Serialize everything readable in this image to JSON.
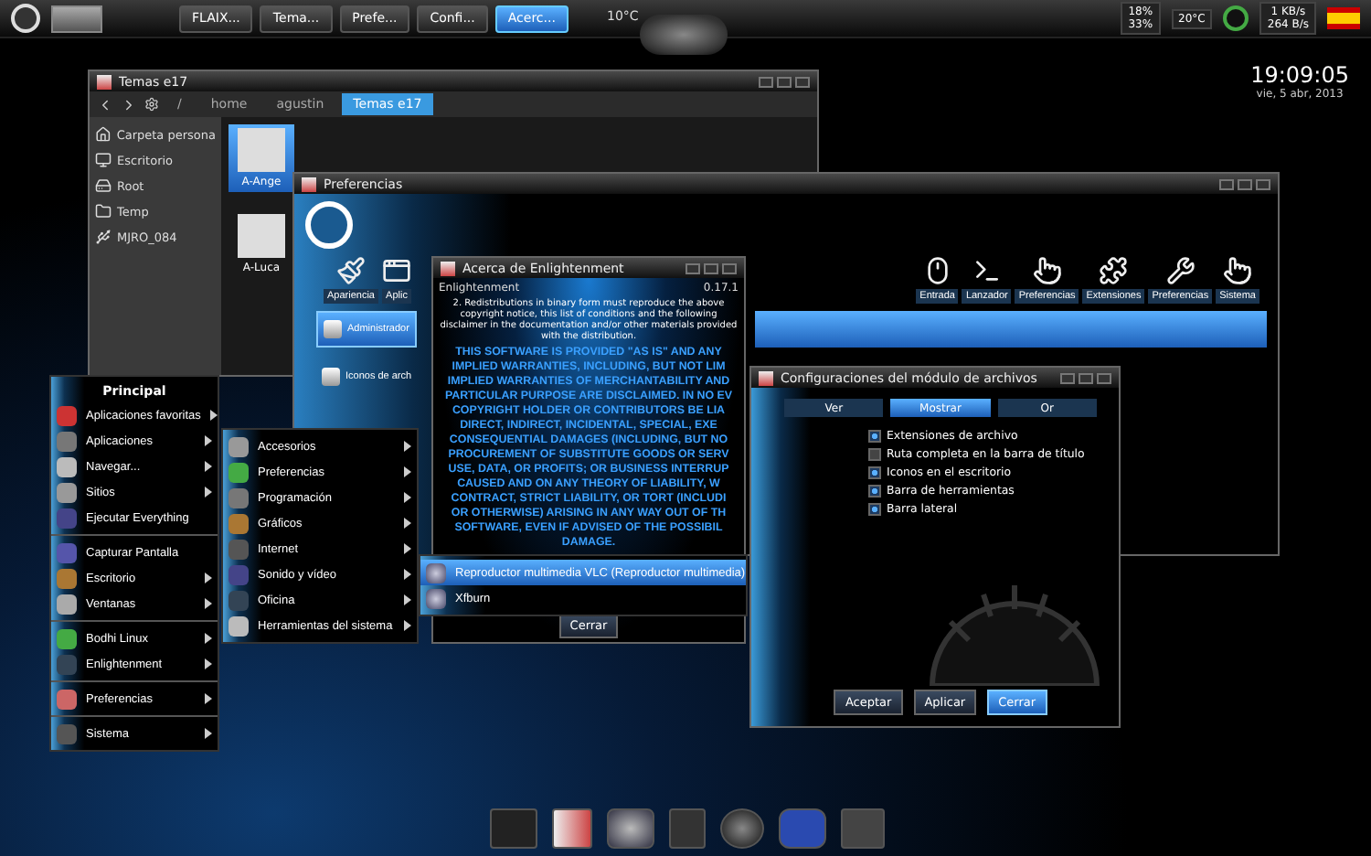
{
  "top_panel": {
    "tasks": [
      {
        "label": "FLAIX...",
        "selected": false
      },
      {
        "label": "Tema...",
        "selected": false
      },
      {
        "label": "Prefe...",
        "selected": false
      },
      {
        "label": "Confi...",
        "selected": false
      },
      {
        "label": "Acerc...",
        "selected": true
      }
    ],
    "weather": "10°C",
    "tray": {
      "cpu": [
        "18%",
        "33%"
      ],
      "temperature": "20°C",
      "net_down": "1 KB/s",
      "net_up": "264 B/s"
    }
  },
  "clock": {
    "time": "19:09:05",
    "date": "vie, 5 abr, 2013"
  },
  "file_window": {
    "title": "Temas e17",
    "path": [
      {
        "label": "/",
        "selected": false
      },
      {
        "label": "home",
        "selected": false
      },
      {
        "label": "agustin",
        "selected": false
      },
      {
        "label": "Temas e17",
        "selected": true
      }
    ],
    "places": [
      "Carpeta persona",
      "Escritorio",
      "Root",
      "Temp",
      "MJRO_084"
    ],
    "files": [
      {
        "name": "A-Ange",
        "selected": true
      },
      {
        "name": "A-Luca",
        "selected": false
      }
    ]
  },
  "prefs_window": {
    "title": "Preferencias",
    "category_groups": [
      [
        "Apariencia",
        "Aplic"
      ],
      [
        "Entrada",
        "Lanzador",
        "Preferencias",
        "Extensiones",
        "Preferencias",
        "Sistema"
      ]
    ],
    "list": [
      {
        "label": "Administrador",
        "selected": true
      },
      {
        "label": "Iconos de arch",
        "selected": false
      }
    ]
  },
  "about_window": {
    "title": "Acerca de Enlightenment",
    "name": "Enlightenment",
    "version": "0.17.1",
    "notice": "2. Redistributions in binary form must reproduce the above copyright notice, this list of conditions and the following disclaimer in the documentation and/or other materials provided with the distribution.",
    "disclaimer": [
      "THIS SOFTWARE IS PROVIDED \"AS IS\" AND ANY",
      "IMPLIED WARRANTIES, INCLUDING, BUT NOT LIM",
      "IMPLIED WARRANTIES OF MERCHANTABILITY AND",
      "PARTICULAR PURPOSE ARE DISCLAIMED. IN NO EV",
      "COPYRIGHT HOLDER OR CONTRIBUTORS BE LIA",
      "DIRECT, INDIRECT, INCIDENTAL, SPECIAL, EXE",
      "CONSEQUENTIAL DAMAGES (INCLUDING, BUT NO",
      "PROCUREMENT OF SUBSTITUTE GOODS OR SERV",
      "USE, DATA, OR PROFITS; OR BUSINESS INTERRUP",
      "CAUSED AND ON ANY THEORY OF LIABILITY, W",
      "CONTRACT, STRICT LIABILITY, OR TORT (INCLUDI",
      "OR OTHERWISE) ARISING IN ANY WAY OUT OF TH",
      "SOFTWARE, EVEN IF ADVISED OF THE POSSIBIL",
      "DAMAGE."
    ],
    "close_button": "Cerrar"
  },
  "main_menu": {
    "title": "Principal",
    "groups": [
      [
        {
          "label": "Aplicaciones favoritas",
          "submenu": true
        },
        {
          "label": "Aplicaciones",
          "submenu": true
        },
        {
          "label": "Navegar...",
          "submenu": true
        },
        {
          "label": "Sitios",
          "submenu": true
        },
        {
          "label": "Ejecutar Everything",
          "submenu": false
        }
      ],
      [
        {
          "label": "Capturar Pantalla",
          "submenu": false
        },
        {
          "label": "Escritorio",
          "submenu": true
        },
        {
          "label": "Ventanas",
          "submenu": true
        }
      ],
      [
        {
          "label": "Bodhi Linux",
          "submenu": true
        },
        {
          "label": "Enlightenment",
          "submenu": true
        }
      ],
      [
        {
          "label": "Preferencias",
          "submenu": true
        }
      ],
      [
        {
          "label": "Sistema",
          "submenu": true
        }
      ]
    ]
  },
  "apps_menu": {
    "items": [
      {
        "label": "Accesorios",
        "submenu": true
      },
      {
        "label": "Preferencias",
        "submenu": true
      },
      {
        "label": "Programación",
        "submenu": true
      },
      {
        "label": "Gráficos",
        "submenu": true
      },
      {
        "label": "Internet",
        "submenu": true
      },
      {
        "label": "Sonido y vídeo",
        "submenu": true
      },
      {
        "label": "Oficina",
        "submenu": true
      },
      {
        "label": "Herramientas del sistema",
        "submenu": true
      }
    ]
  },
  "video_menu": {
    "items": [
      {
        "label": "Reproductor multimedia VLC (Reproductor multimedia)",
        "selected": true
      },
      {
        "label": "Xfburn",
        "selected": false
      }
    ]
  },
  "config_dialog": {
    "title": "Configuraciones del módulo de archivos",
    "tabs": [
      {
        "label": "Ver",
        "selected": false
      },
      {
        "label": "Mostrar",
        "selected": true
      },
      {
        "label": "Or",
        "selected": false
      }
    ],
    "options": [
      {
        "label": "Extensiones de archivo",
        "checked": true
      },
      {
        "label": "Ruta completa en la barra de título",
        "checked": false
      },
      {
        "label": "Iconos en el escritorio",
        "checked": true
      },
      {
        "label": "Barra de herramientas",
        "checked": true
      },
      {
        "label": "Barra lateral",
        "checked": true
      }
    ],
    "buttons": [
      {
        "label": "Aceptar",
        "focused": false
      },
      {
        "label": "Aplicar",
        "focused": false
      },
      {
        "label": "Cerrar",
        "focused": true
      }
    ]
  }
}
